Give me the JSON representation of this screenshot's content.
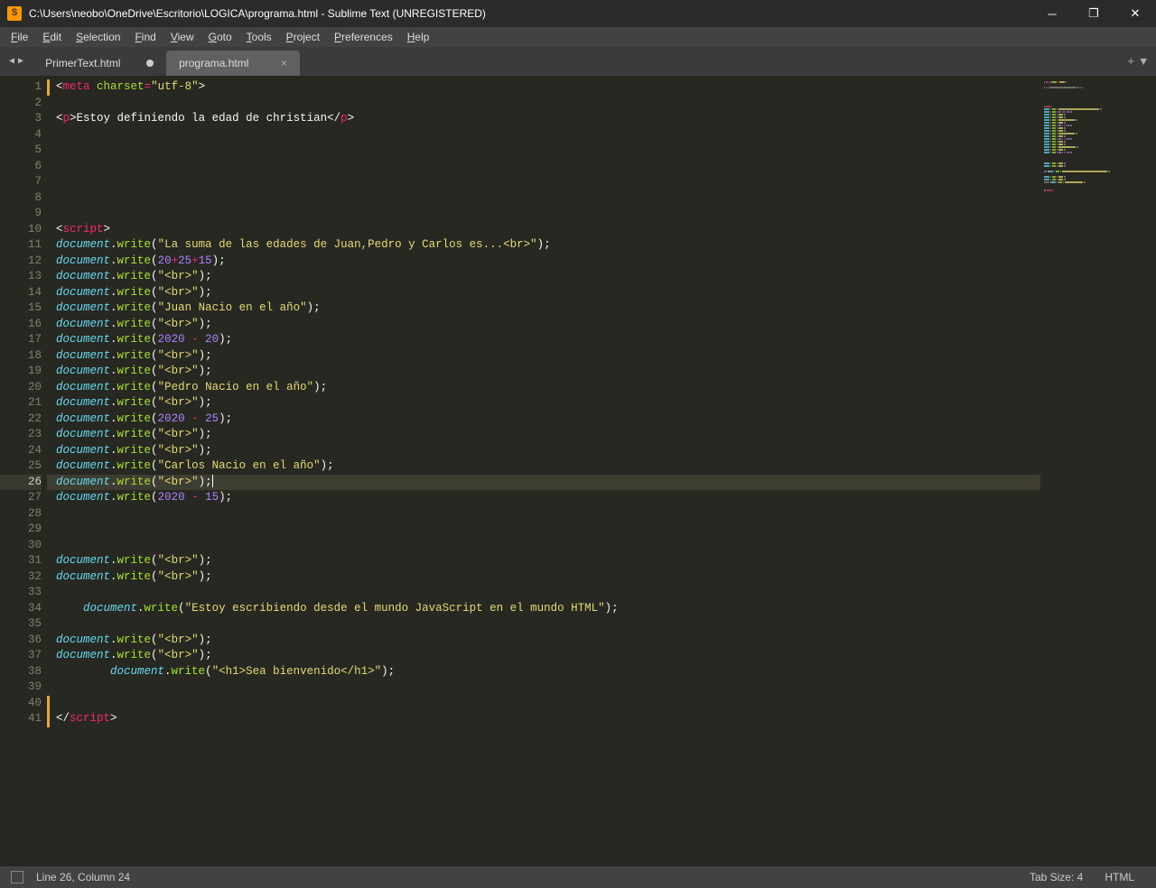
{
  "window": {
    "title": "C:\\Users\\neobo\\OneDrive\\Escritorio\\LOGICA\\programa.html - Sublime Text (UNREGISTERED)",
    "app_icon_letter": "S"
  },
  "menu": [
    "File",
    "Edit",
    "Selection",
    "Find",
    "View",
    "Goto",
    "Tools",
    "Project",
    "Preferences",
    "Help"
  ],
  "tabs": [
    {
      "label": "PrimerText.html",
      "active": false,
      "dirty": true
    },
    {
      "label": "programa.html",
      "active": true,
      "dirty": false
    }
  ],
  "status": {
    "position": "Line 26, Column 24",
    "tabsize": "Tab Size: 4",
    "syntax": "HTML"
  },
  "cursor_line": 26,
  "line_count": 41,
  "modified_ranges": [
    [
      1,
      1
    ],
    [
      40,
      41
    ]
  ],
  "code_lines": [
    {
      "n": 1,
      "segs": [
        [
          "p",
          "<"
        ],
        [
          "t",
          "meta"
        ],
        [
          "p",
          " "
        ],
        [
          "a",
          "charset"
        ],
        [
          "k",
          "="
        ],
        [
          "s",
          "\"utf-8\""
        ],
        [
          "p",
          ">"
        ]
      ]
    },
    {
      "n": 2,
      "segs": []
    },
    {
      "n": 3,
      "segs": [
        [
          "p",
          "<"
        ],
        [
          "t",
          "p"
        ],
        [
          "p",
          ">"
        ],
        [
          "p",
          "Estoy definiendo la edad de christian"
        ],
        [
          "p",
          "</"
        ],
        [
          "t",
          "p"
        ],
        [
          "p",
          ">"
        ]
      ]
    },
    {
      "n": 4,
      "segs": []
    },
    {
      "n": 5,
      "segs": []
    },
    {
      "n": 6,
      "segs": []
    },
    {
      "n": 7,
      "segs": []
    },
    {
      "n": 8,
      "segs": []
    },
    {
      "n": 9,
      "segs": []
    },
    {
      "n": 10,
      "segs": [
        [
          "p",
          "<"
        ],
        [
          "t",
          "script"
        ],
        [
          "p",
          ">"
        ]
      ]
    },
    {
      "n": 11,
      "segs": [
        [
          "o",
          "document"
        ],
        [
          "p",
          "."
        ],
        [
          "a",
          "write"
        ],
        [
          "p",
          "("
        ],
        [
          "s",
          "\"La suma de las edades de Juan,Pedro y Carlos es...<br>\""
        ],
        [
          "p",
          ");"
        ]
      ]
    },
    {
      "n": 12,
      "segs": [
        [
          "o",
          "document"
        ],
        [
          "p",
          "."
        ],
        [
          "a",
          "write"
        ],
        [
          "p",
          "("
        ],
        [
          "n",
          "20"
        ],
        [
          "k",
          "+"
        ],
        [
          "n",
          "25"
        ],
        [
          "k",
          "+"
        ],
        [
          "n",
          "15"
        ],
        [
          "p",
          ");"
        ]
      ]
    },
    {
      "n": 13,
      "segs": [
        [
          "o",
          "document"
        ],
        [
          "p",
          "."
        ],
        [
          "a",
          "write"
        ],
        [
          "p",
          "("
        ],
        [
          "s",
          "\"<br>\""
        ],
        [
          "p",
          ");"
        ]
      ]
    },
    {
      "n": 14,
      "segs": [
        [
          "o",
          "document"
        ],
        [
          "p",
          "."
        ],
        [
          "a",
          "write"
        ],
        [
          "p",
          "("
        ],
        [
          "s",
          "\"<br>\""
        ],
        [
          "p",
          ");"
        ]
      ]
    },
    {
      "n": 15,
      "segs": [
        [
          "o",
          "document"
        ],
        [
          "p",
          "."
        ],
        [
          "a",
          "write"
        ],
        [
          "p",
          "("
        ],
        [
          "s",
          "\"Juan Nacio en el año\""
        ],
        [
          "p",
          ");"
        ]
      ]
    },
    {
      "n": 16,
      "segs": [
        [
          "o",
          "document"
        ],
        [
          "p",
          "."
        ],
        [
          "a",
          "write"
        ],
        [
          "p",
          "("
        ],
        [
          "s",
          "\"<br>\""
        ],
        [
          "p",
          ");"
        ]
      ]
    },
    {
      "n": 17,
      "segs": [
        [
          "o",
          "document"
        ],
        [
          "p",
          "."
        ],
        [
          "a",
          "write"
        ],
        [
          "p",
          "("
        ],
        [
          "n",
          "2020"
        ],
        [
          "p",
          " "
        ],
        [
          "k",
          "-"
        ],
        [
          "p",
          " "
        ],
        [
          "n",
          "20"
        ],
        [
          "p",
          ");"
        ]
      ]
    },
    {
      "n": 18,
      "segs": [
        [
          "o",
          "document"
        ],
        [
          "p",
          "."
        ],
        [
          "a",
          "write"
        ],
        [
          "p",
          "("
        ],
        [
          "s",
          "\"<br>\""
        ],
        [
          "p",
          ");"
        ]
      ]
    },
    {
      "n": 19,
      "segs": [
        [
          "o",
          "document"
        ],
        [
          "p",
          "."
        ],
        [
          "a",
          "write"
        ],
        [
          "p",
          "("
        ],
        [
          "s",
          "\"<br>\""
        ],
        [
          "p",
          ");"
        ]
      ]
    },
    {
      "n": 20,
      "segs": [
        [
          "o",
          "document"
        ],
        [
          "p",
          "."
        ],
        [
          "a",
          "write"
        ],
        [
          "p",
          "("
        ],
        [
          "s",
          "\"Pedro Nacio en el año\""
        ],
        [
          "p",
          ");"
        ]
      ]
    },
    {
      "n": 21,
      "segs": [
        [
          "o",
          "document"
        ],
        [
          "p",
          "."
        ],
        [
          "a",
          "write"
        ],
        [
          "p",
          "("
        ],
        [
          "s",
          "\"<br>\""
        ],
        [
          "p",
          ");"
        ]
      ]
    },
    {
      "n": 22,
      "segs": [
        [
          "o",
          "document"
        ],
        [
          "p",
          "."
        ],
        [
          "a",
          "write"
        ],
        [
          "p",
          "("
        ],
        [
          "n",
          "2020"
        ],
        [
          "p",
          " "
        ],
        [
          "k",
          "-"
        ],
        [
          "p",
          " "
        ],
        [
          "n",
          "25"
        ],
        [
          "p",
          ");"
        ]
      ]
    },
    {
      "n": 23,
      "segs": [
        [
          "o",
          "document"
        ],
        [
          "p",
          "."
        ],
        [
          "a",
          "write"
        ],
        [
          "p",
          "("
        ],
        [
          "s",
          "\"<br>\""
        ],
        [
          "p",
          ");"
        ]
      ]
    },
    {
      "n": 24,
      "segs": [
        [
          "o",
          "document"
        ],
        [
          "p",
          "."
        ],
        [
          "a",
          "write"
        ],
        [
          "p",
          "("
        ],
        [
          "s",
          "\"<br>\""
        ],
        [
          "p",
          ");"
        ]
      ]
    },
    {
      "n": 25,
      "segs": [
        [
          "o",
          "document"
        ],
        [
          "p",
          "."
        ],
        [
          "a",
          "write"
        ],
        [
          "p",
          "("
        ],
        [
          "s",
          "\"Carlos Nacio en el año\""
        ],
        [
          "p",
          ");"
        ]
      ]
    },
    {
      "n": 26,
      "segs": [
        [
          "o",
          "document"
        ],
        [
          "p",
          "."
        ],
        [
          "a",
          "write"
        ],
        [
          "p",
          "("
        ],
        [
          "s",
          "\"<br>\""
        ],
        [
          "p",
          ");"
        ]
      ],
      "cursor_after": true
    },
    {
      "n": 27,
      "segs": [
        [
          "o",
          "document"
        ],
        [
          "p",
          "."
        ],
        [
          "a",
          "write"
        ],
        [
          "p",
          "("
        ],
        [
          "n",
          "2020"
        ],
        [
          "p",
          " "
        ],
        [
          "k",
          "-"
        ],
        [
          "p",
          " "
        ],
        [
          "n",
          "15"
        ],
        [
          "p",
          ");"
        ]
      ]
    },
    {
      "n": 28,
      "segs": []
    },
    {
      "n": 29,
      "segs": []
    },
    {
      "n": 30,
      "segs": []
    },
    {
      "n": 31,
      "segs": [
        [
          "o",
          "document"
        ],
        [
          "p",
          "."
        ],
        [
          "a",
          "write"
        ],
        [
          "p",
          "("
        ],
        [
          "s",
          "\"<br>\""
        ],
        [
          "p",
          ");"
        ]
      ]
    },
    {
      "n": 32,
      "segs": [
        [
          "o",
          "document"
        ],
        [
          "p",
          "."
        ],
        [
          "a",
          "write"
        ],
        [
          "p",
          "("
        ],
        [
          "s",
          "\"<br>\""
        ],
        [
          "p",
          ");"
        ]
      ]
    },
    {
      "n": 33,
      "segs": []
    },
    {
      "n": 34,
      "segs": [
        [
          "p",
          "    "
        ],
        [
          "o",
          "document"
        ],
        [
          "p",
          "."
        ],
        [
          "a",
          "write"
        ],
        [
          "p",
          "("
        ],
        [
          "s",
          "\"Estoy escribiendo desde el mundo JavaScript en el mundo HTML\""
        ],
        [
          "p",
          ");"
        ]
      ]
    },
    {
      "n": 35,
      "segs": []
    },
    {
      "n": 36,
      "segs": [
        [
          "o",
          "document"
        ],
        [
          "p",
          "."
        ],
        [
          "a",
          "write"
        ],
        [
          "p",
          "("
        ],
        [
          "s",
          "\"<br>\""
        ],
        [
          "p",
          ");"
        ]
      ]
    },
    {
      "n": 37,
      "segs": [
        [
          "o",
          "document"
        ],
        [
          "p",
          "."
        ],
        [
          "a",
          "write"
        ],
        [
          "p",
          "("
        ],
        [
          "s",
          "\"<br>\""
        ],
        [
          "p",
          ");"
        ]
      ]
    },
    {
      "n": 38,
      "segs": [
        [
          "p",
          "        "
        ],
        [
          "o",
          "document"
        ],
        [
          "p",
          "."
        ],
        [
          "a",
          "write"
        ],
        [
          "p",
          "("
        ],
        [
          "s",
          "\"<h1>Sea bienvenido</h1>\""
        ],
        [
          "p",
          ");"
        ]
      ]
    },
    {
      "n": 39,
      "segs": []
    },
    {
      "n": 40,
      "segs": []
    },
    {
      "n": 41,
      "segs": [
        [
          "p",
          "</"
        ],
        [
          "t",
          "script"
        ],
        [
          "p",
          ">"
        ]
      ]
    }
  ]
}
